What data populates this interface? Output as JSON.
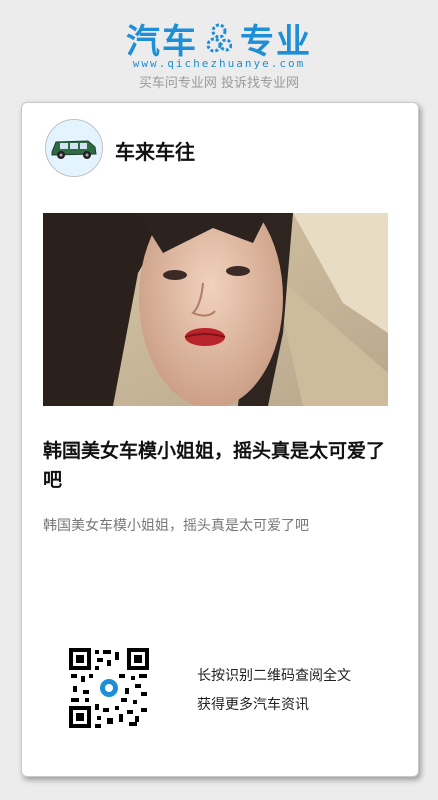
{
  "header": {
    "logo_left": "汽车",
    "logo_right": "专业",
    "url": "www.qichezhuanye.com",
    "slogan": "买车问专业网 投诉找专业网"
  },
  "card": {
    "author": "车来车往",
    "title": "韩国美女车模小姐姐，摇头真是太可爱了吧",
    "summary": "韩国美女车模小姐姐，摇头真是太可爱了吧",
    "qr_line1": "长按识别二维码查阅全文",
    "qr_line2": "获得更多汽车资讯"
  },
  "colors": {
    "brand": "#1e8fd6"
  },
  "icons": {
    "logo_mark": "gear-icon",
    "avatar": "car-icon"
  }
}
